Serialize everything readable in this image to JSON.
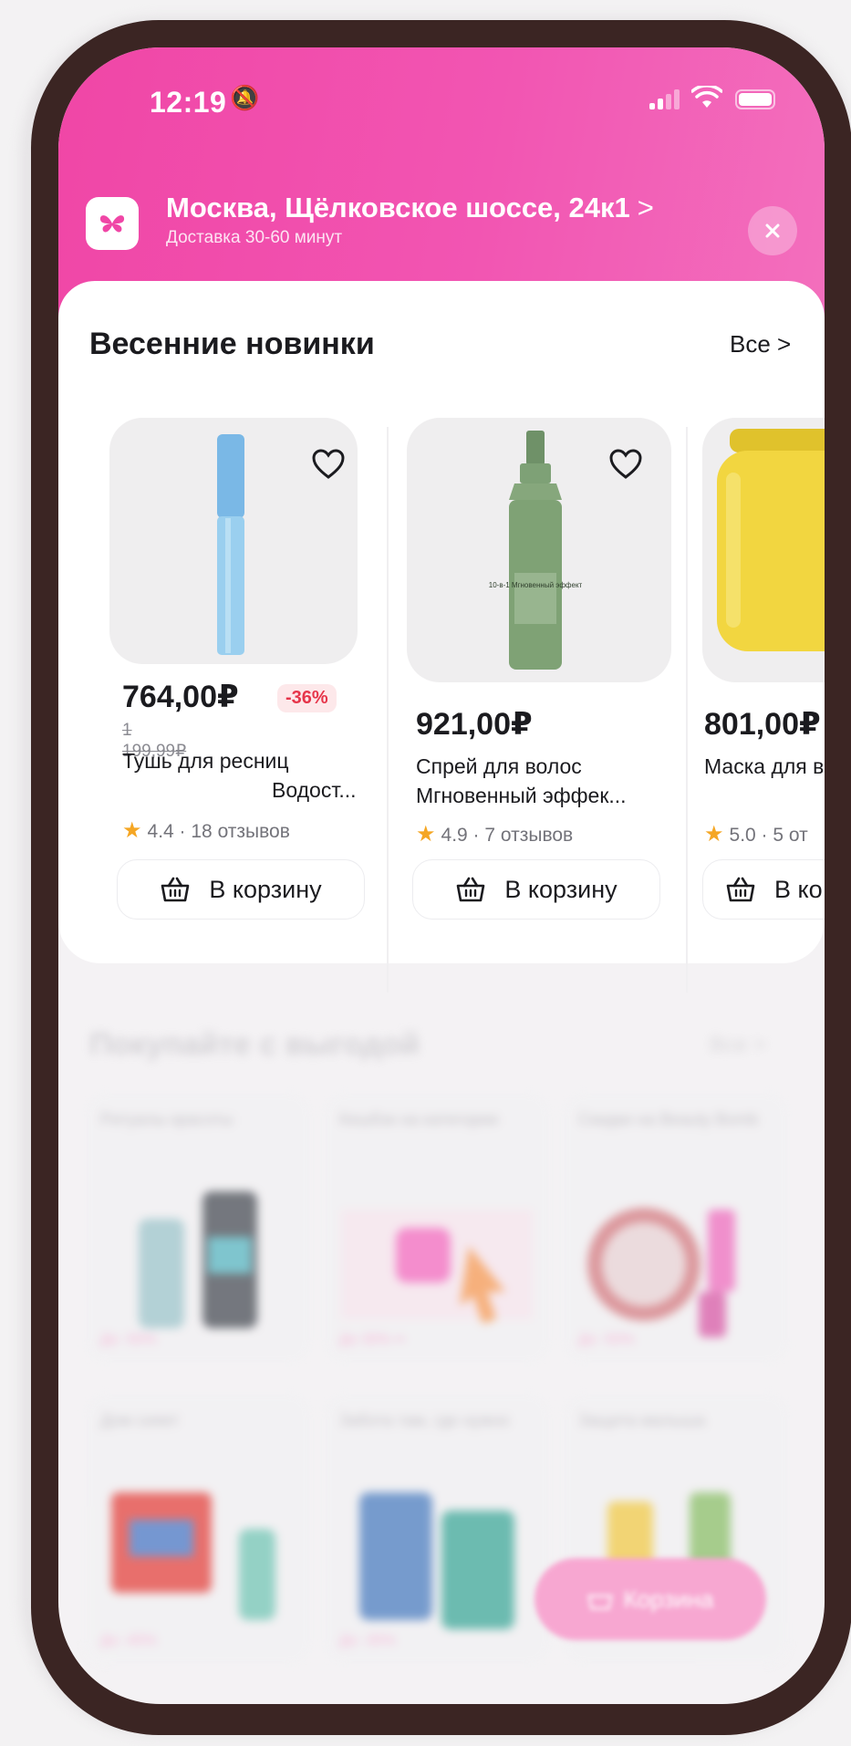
{
  "status_bar": {
    "time": "12:19"
  },
  "header": {
    "address": "Москва, Щёлковское шоссе, 24к1",
    "delivery": "Доставка 30-60 минут"
  },
  "section": {
    "title": "Весенние новинки",
    "see_all": "Все"
  },
  "products": [
    {
      "price": "764,00₽",
      "discount": "-36%",
      "old_price": "1 199,99₽",
      "name_line1": "Тушь для ресниц",
      "name_line2": "Водост...",
      "rating": "4.4 · 18 отзывов",
      "cart_label": "В корзину"
    },
    {
      "price": "921,00₽",
      "name_line1": "Спрей для волос",
      "name_line2": "Мгновенный эффек...",
      "rating": "4.9 · 7 отзывов",
      "cart_label": "В корзину",
      "bottle_label": "10-в-1 Мгновенный эффект"
    },
    {
      "price": "801,00₽",
      "name_line1": "Маска для в",
      "rating": "5.0 · 5 от",
      "cart_label": "В ко"
    }
  ],
  "promo_section": {
    "title": "Покупайте с выгодой",
    "see_all": "Все",
    "tiles": [
      {
        "label": "Ритуалы красоты",
        "badge": "До -50%"
      },
      {
        "label": "Кешбэк на категории",
        "badge": "До 30% ••"
      },
      {
        "label": "Скидки на Beauty Bomb",
        "badge": "До -50%"
      },
      {
        "label": "Дом сияет",
        "badge": "До -45%"
      },
      {
        "label": "Забота там, где нужно",
        "badge": "До -35%"
      },
      {
        "label": "Защита малыша",
        "badge": ""
      }
    ]
  },
  "floating_cart": {
    "label": "Корзина"
  },
  "colors": {
    "brand_pink": "#f046a6",
    "star": "#f5a623",
    "discount_red": "#e6354a"
  }
}
